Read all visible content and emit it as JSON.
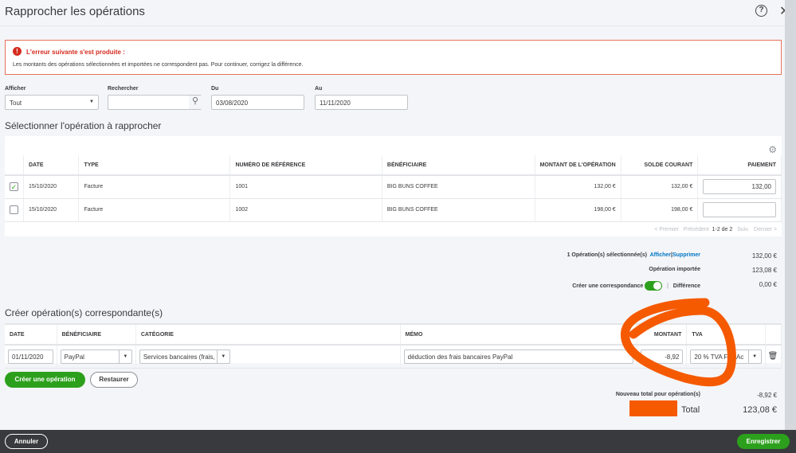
{
  "dialog": {
    "title": "Rapprocher les opérations",
    "help_icon": "help-circle-icon",
    "close_icon": "close-icon"
  },
  "error": {
    "icon": "alert-icon",
    "heading": "L'erreur suivante s'est produite :",
    "message": "Les montants des opérations sélectionnées et importées ne correspondent pas. Pour continuer, corrigez la différence."
  },
  "filters": {
    "show_label": "Afficher",
    "show_value": "Tout",
    "search_label": "Rechercher",
    "search_value": "",
    "from_label": "Du",
    "from_value": "03/08/2020",
    "to_label": "Au",
    "to_value": "11/11/2020"
  },
  "select_section": {
    "title": "Sélectionner l'opération à rapprocher",
    "columns": [
      "DATE",
      "TYPE",
      "NUMÉRO DE RÉFÉRENCE",
      "BÉNÉFICIAIRE",
      "MONTANT DE L'OPÉRATION",
      "SOLDE COURANT",
      "PAIEMENT"
    ],
    "rows": [
      {
        "checked": true,
        "date": "15/10/2020",
        "type": "Facture",
        "ref": "1001",
        "payee": "BIG BUNS COFFEE",
        "amount": "132,00 €",
        "balance": "132,00 €",
        "payment": "132,00"
      },
      {
        "checked": false,
        "date": "15/10/2020",
        "type": "Facture",
        "ref": "1002",
        "payee": "BIG BUNS COFFEE",
        "amount": "198,00 €",
        "balance": "198,00 €",
        "payment": ""
      }
    ],
    "pagination": {
      "first": "< Premier",
      "prev": "Précédent",
      "range": "1-2 de 2",
      "next": "Suiv.",
      "last": "Dernier >"
    }
  },
  "summary": {
    "selected": "1 Opération(s) sélectionnée(s)",
    "show": "Afficher",
    "sep": "|",
    "delete": "Supprimer",
    "selected_value": "132,00 €",
    "imported": "Opération importée",
    "imported_value": "123,08 €",
    "create_match": "Créer une correspondance",
    "toggle_on": true,
    "difference": "Différence",
    "difference_value": "0,00 €"
  },
  "create_section": {
    "title": "Créer opération(s) correspondante(s)",
    "columns": [
      "DATE",
      "BÉNÉFICIAIRE",
      "CATÉGORIE",
      "MÉMO",
      "MONTANT",
      "TVA"
    ],
    "row": {
      "date": "01/11/2020",
      "payee": "PayPal",
      "category": "Services bancaires (frais,",
      "memo": "déduction des frais bancaires PayPal",
      "amount": "-8,92",
      "tva": "20 % TVA FR (Ac"
    },
    "add_button": "Créer une opération",
    "reset_button": "Restaurer",
    "new_total_label": "Nouveau total pour opération(s)",
    "new_total_value": "-8,92 €",
    "total_label": "Total",
    "total_value": "123,08 €"
  },
  "footer": {
    "cancel": "Annuler",
    "save": "Enregistrer"
  },
  "colors": {
    "accent": "#2ca01c",
    "error": "#d52b1e",
    "link": "#0077c5",
    "annotation": "#f55a00"
  }
}
